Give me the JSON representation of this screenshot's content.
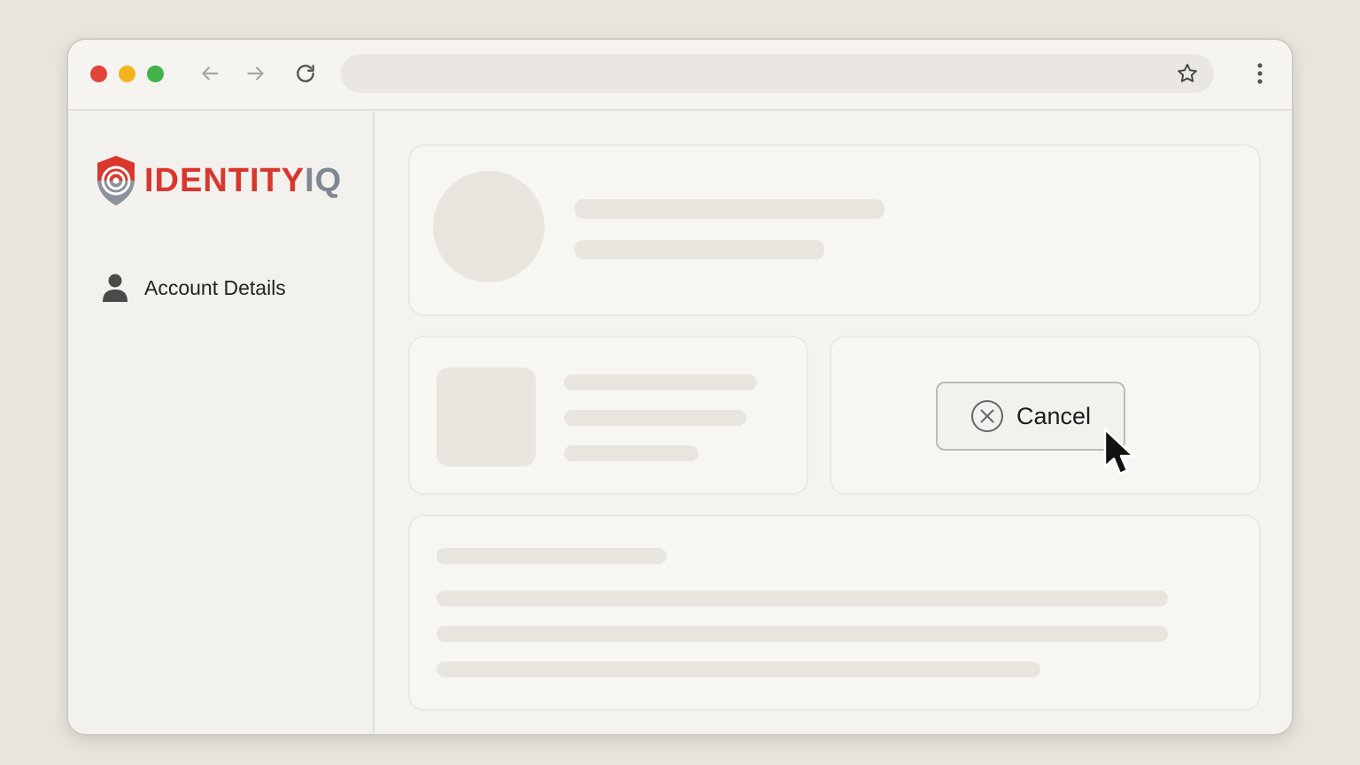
{
  "browser": {
    "traffic_lights": {
      "close": "#e0443a",
      "minimize": "#f2b31f",
      "maximize": "#3fb24a"
    },
    "icons": [
      "back-arrow-icon",
      "forward-arrow-icon",
      "reload-icon",
      "bookmark-star-icon",
      "more-vert-icon"
    ],
    "address_value": ""
  },
  "sidebar": {
    "logo": {
      "part1": "IDENTITY",
      "part2": "IQ",
      "brand_red": "#d9372e",
      "brand_gray": "#7f8793"
    },
    "items": [
      {
        "label": "Account Details",
        "icon": "user-icon"
      }
    ]
  },
  "main": {
    "cancel_button": {
      "label": "Cancel",
      "icon": "close-circle-icon"
    }
  },
  "cursor": {
    "icon": "mouse-pointer-icon"
  }
}
